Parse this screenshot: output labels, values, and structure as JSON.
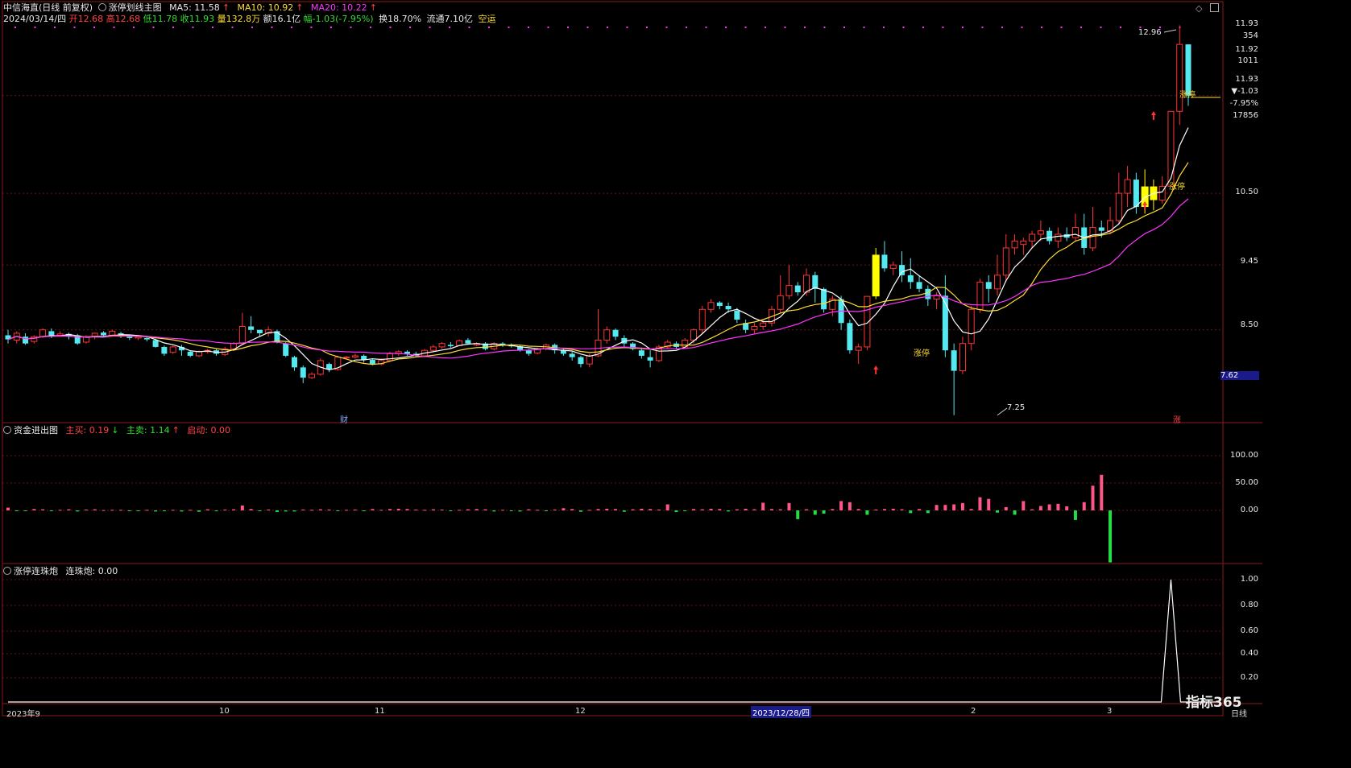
{
  "header": {
    "stock": "中信海直(日线 前复权)",
    "indicator": "涨停划线主图",
    "ma5": "MA5: 11.58",
    "ma10": "MA10: 10.92",
    "ma20": "MA20: 10.22",
    "arrow_up": "↑",
    "arrow_down": "↓",
    "date": "2024/03/14/四",
    "open": "开12.68",
    "high": "高12.68",
    "low": "低11.78",
    "close": "收11.93",
    "volume": "量132.8万",
    "amount": "额16.1亿",
    "change": "幅-1.03(-7.95%)",
    "turnover": "换18.70%",
    "float": "流通7.10亿",
    "concept": "空运"
  },
  "right_panel": {
    "price": "11.93",
    "v354": "354",
    "price2": "11.92",
    "v1011": "1011",
    "price3": "11.93",
    "chg": "▼-1.03",
    "pct": "-7.95%",
    "v17856": "17856"
  },
  "price_axis": [
    "10.50",
    "9.45",
    "8.50",
    "7.62"
  ],
  "annotations": {
    "high_label": "12.96",
    "low_label": "7.25",
    "zt": "涨停",
    "cai": "财",
    "zhang": "涨"
  },
  "panel2": {
    "name": "资金进出图",
    "buy": "主买: 0.19",
    "sell": "主卖: 1.14",
    "start": "启动: 0.00",
    "axis": [
      "100.00",
      "50.00",
      "0.00"
    ]
  },
  "panel3": {
    "name": "涨停连珠炮",
    "value_label": "连珠炮: 0.00",
    "axis": [
      "1.00",
      "0.80",
      "0.60",
      "0.40",
      "0.20"
    ]
  },
  "time_axis": [
    {
      "label": "2023年9"
    },
    {
      "label": "10"
    },
    {
      "label": "11"
    },
    {
      "label": "12"
    },
    {
      "label": "2023/12/28/四"
    },
    {
      "label": "2"
    },
    {
      "label": "3"
    }
  ],
  "period": "日线",
  "brand": "指标365",
  "colors": {
    "up": "#ff3333",
    "down": "#54e8f0",
    "zt": "#ffff00",
    "ma5": "#ffffff",
    "ma10": "#ffdd33",
    "ma20": "#ff33ff",
    "buy": "#ff5588",
    "sell": "#22dd44"
  },
  "chart_data": {
    "type": "candlestick",
    "ylim": [
      7.2,
      13.0
    ],
    "candles": [
      [
        8.42,
        8.36,
        8.5,
        8.3
      ],
      [
        8.35,
        8.45,
        8.48,
        8.3
      ],
      [
        8.4,
        8.3,
        8.45,
        8.28
      ],
      [
        8.33,
        8.4,
        8.42,
        8.3
      ],
      [
        8.4,
        8.5,
        8.52,
        8.38
      ],
      [
        8.48,
        8.42,
        8.52,
        8.38
      ],
      [
        8.42,
        8.44,
        8.48,
        8.4
      ],
      [
        8.44,
        8.4,
        8.46,
        8.36
      ],
      [
        8.42,
        8.3,
        8.44,
        8.28
      ],
      [
        8.32,
        8.4,
        8.42,
        8.3
      ],
      [
        8.4,
        8.45,
        8.46,
        8.36
      ],
      [
        8.46,
        8.42,
        8.48,
        8.4
      ],
      [
        8.42,
        8.48,
        8.5,
        8.4
      ],
      [
        8.45,
        8.4,
        8.47,
        8.38
      ],
      [
        8.4,
        8.38,
        8.42,
        8.35
      ],
      [
        8.38,
        8.4,
        8.42,
        8.35
      ],
      [
        8.38,
        8.36,
        8.4,
        8.33
      ],
      [
        8.35,
        8.25,
        8.37,
        8.24
      ],
      [
        8.25,
        8.15,
        8.27,
        8.12
      ],
      [
        8.17,
        8.25,
        8.27,
        8.15
      ],
      [
        8.25,
        8.2,
        8.28,
        8.12
      ],
      [
        8.18,
        8.12,
        8.2,
        8.1
      ],
      [
        8.12,
        8.18,
        8.2,
        8.1
      ],
      [
        8.18,
        8.2,
        8.22,
        8.15
      ],
      [
        8.2,
        8.15,
        8.22,
        8.12
      ],
      [
        8.14,
        8.22,
        8.25,
        8.12
      ],
      [
        8.22,
        8.3,
        8.32,
        8.2
      ],
      [
        8.3,
        8.55,
        8.75,
        8.28
      ],
      [
        8.55,
        8.5,
        8.7,
        8.45
      ],
      [
        8.5,
        8.45,
        8.5,
        8.4
      ],
      [
        8.45,
        8.5,
        8.55,
        8.4
      ],
      [
        8.48,
        8.32,
        8.5,
        8.3
      ],
      [
        8.3,
        8.12,
        8.32,
        8.1
      ],
      [
        8.1,
        7.95,
        8.12,
        7.9
      ],
      [
        7.95,
        7.8,
        7.98,
        7.72
      ],
      [
        7.8,
        7.85,
        7.88,
        7.78
      ],
      [
        7.85,
        8.05,
        8.08,
        7.83
      ],
      [
        8.0,
        7.92,
        8.02,
        7.88
      ],
      [
        7.92,
        8.1,
        8.12,
        7.9
      ],
      [
        8.1,
        8.1,
        8.12,
        8.08
      ],
      [
        8.1,
        8.12,
        8.15,
        8.08
      ],
      [
        8.12,
        8.06,
        8.14,
        8.02
      ],
      [
        8.06,
        8.0,
        8.08,
        7.98
      ],
      [
        8.0,
        8.05,
        8.08,
        7.98
      ],
      [
        8.05,
        8.15,
        8.18,
        8.03
      ],
      [
        8.15,
        8.18,
        8.2,
        8.12
      ],
      [
        8.18,
        8.15,
        8.2,
        8.12
      ],
      [
        8.15,
        8.12,
        8.18,
        8.1
      ],
      [
        8.12,
        8.2,
        8.22,
        8.1
      ],
      [
        8.2,
        8.25,
        8.28,
        8.18
      ],
      [
        8.25,
        8.3,
        8.32,
        8.22
      ],
      [
        8.28,
        8.26,
        8.32,
        8.24
      ],
      [
        8.27,
        8.34,
        8.36,
        8.26
      ],
      [
        8.35,
        8.3,
        8.38,
        8.28
      ],
      [
        8.28,
        8.3,
        8.32,
        8.26
      ],
      [
        8.3,
        8.22,
        8.32,
        8.2
      ],
      [
        8.22,
        8.3,
        8.32,
        8.2
      ],
      [
        8.3,
        8.28,
        8.32,
        8.25
      ],
      [
        8.27,
        8.26,
        8.3,
        8.24
      ],
      [
        8.26,
        8.2,
        8.28,
        8.18
      ],
      [
        8.2,
        8.15,
        8.22,
        8.12
      ],
      [
        8.16,
        8.22,
        8.24,
        8.14
      ],
      [
        8.22,
        8.28,
        8.3,
        8.2
      ],
      [
        8.28,
        8.2,
        8.3,
        8.15
      ],
      [
        8.2,
        8.15,
        8.22,
        8.12
      ],
      [
        8.15,
        8.1,
        8.18,
        8.05
      ],
      [
        8.1,
        8.0,
        8.12,
        7.95
      ],
      [
        8.0,
        8.12,
        8.15,
        7.95
      ],
      [
        8.12,
        8.35,
        8.8,
        8.1
      ],
      [
        8.35,
        8.5,
        8.55,
        8.3
      ],
      [
        8.5,
        8.4,
        8.52,
        8.35
      ],
      [
        8.38,
        8.3,
        8.42,
        8.25
      ],
      [
        8.3,
        8.22,
        8.32,
        8.2
      ],
      [
        8.2,
        8.12,
        8.24,
        8.08
      ],
      [
        8.1,
        8.05,
        8.2,
        7.95
      ],
      [
        8.05,
        8.25,
        8.28,
        8.03
      ],
      [
        8.25,
        8.32,
        8.35,
        8.22
      ],
      [
        8.3,
        8.25,
        8.33,
        8.22
      ],
      [
        8.25,
        8.35,
        8.38,
        8.24
      ],
      [
        8.35,
        8.5,
        8.52,
        8.3
      ],
      [
        8.5,
        8.8,
        8.85,
        8.45
      ],
      [
        8.8,
        8.9,
        8.95,
        8.75
      ],
      [
        8.9,
        8.85,
        8.92,
        8.8
      ],
      [
        8.85,
        8.8,
        8.9,
        8.75
      ],
      [
        8.78,
        8.65,
        8.82,
        8.6
      ],
      [
        8.6,
        8.5,
        8.65,
        8.45
      ],
      [
        8.5,
        8.55,
        8.6,
        8.45
      ],
      [
        8.55,
        8.6,
        8.65,
        8.5
      ],
      [
        8.6,
        8.8,
        8.85,
        8.55
      ],
      [
        8.8,
        9.0,
        9.3,
        8.75
      ],
      [
        9.0,
        9.15,
        9.45,
        8.95
      ],
      [
        9.15,
        9.05,
        9.2,
        9.0
      ],
      [
        9.05,
        9.3,
        9.4,
        9.0
      ],
      [
        9.3,
        9.1,
        9.35,
        8.9
      ],
      [
        9.1,
        8.8,
        9.12,
        8.75
      ],
      [
        8.8,
        8.95,
        9.0,
        8.7
      ],
      [
        8.95,
        8.6,
        9.0,
        8.5
      ],
      [
        8.6,
        8.2,
        8.65,
        8.15
      ],
      [
        8.2,
        8.25,
        8.3,
        8.0
      ],
      [
        8.25,
        8.99,
        8.99,
        8.2
      ],
      [
        8.99,
        9.6,
        9.7,
        8.95
      ],
      [
        9.6,
        9.4,
        9.8,
        9.35
      ],
      [
        9.4,
        9.45,
        9.5,
        9.3
      ],
      [
        9.45,
        9.3,
        9.65,
        9.2
      ],
      [
        9.3,
        9.2,
        9.55,
        9.1
      ],
      [
        9.2,
        9.1,
        9.3,
        9.05
      ],
      [
        9.1,
        8.95,
        9.15,
        8.85
      ],
      [
        8.95,
        9.0,
        9.05,
        8.8
      ],
      [
        9.0,
        8.2,
        9.3,
        8.1
      ],
      [
        8.2,
        7.9,
        8.3,
        7.25
      ],
      [
        7.9,
        8.3,
        8.4,
        7.85
      ],
      [
        8.3,
        8.8,
        8.85,
        8.2
      ],
      [
        8.8,
        9.2,
        9.25,
        8.75
      ],
      [
        9.2,
        9.1,
        9.3,
        8.9
      ],
      [
        9.1,
        9.3,
        9.6,
        9.0
      ],
      [
        9.3,
        9.7,
        9.9,
        9.2
      ],
      [
        9.7,
        9.8,
        9.9,
        9.6
      ],
      [
        9.75,
        9.8,
        9.85,
        9.6
      ],
      [
        9.8,
        9.9,
        9.95,
        9.7
      ],
      [
        9.9,
        9.95,
        10.1,
        9.8
      ],
      [
        9.95,
        9.8,
        10.0,
        9.75
      ],
      [
        9.8,
        9.9,
        10.0,
        9.7
      ],
      [
        9.9,
        9.85,
        10.0,
        9.8
      ],
      [
        9.85,
        10.0,
        10.2,
        9.8
      ],
      [
        10.0,
        9.7,
        10.2,
        9.6
      ],
      [
        9.7,
        10.0,
        10.3,
        9.65
      ],
      [
        10.0,
        9.95,
        10.1,
        9.85
      ],
      [
        9.95,
        10.1,
        10.3,
        9.9
      ],
      [
        10.1,
        10.5,
        10.8,
        10.05
      ],
      [
        10.5,
        10.7,
        10.9,
        10.3
      ],
      [
        10.7,
        10.3,
        10.8,
        10.2
      ],
      [
        10.3,
        10.6,
        10.85,
        10.2
      ],
      [
        10.6,
        10.4,
        10.7,
        10.25
      ],
      [
        10.4,
        10.6,
        10.75,
        10.35
      ],
      [
        10.6,
        11.7,
        11.7,
        10.6
      ],
      [
        11.7,
        12.68,
        12.96,
        11.5
      ],
      [
        12.68,
        11.93,
        12.68,
        11.78
      ]
    ],
    "ma5": [],
    "flow": [
      0.1,
      -0.03,
      -0.02,
      0.05,
      0.04,
      -0.03,
      0.02,
      0.04,
      -0.04,
      0.03,
      0.04,
      0.01,
      0.02,
      0.02,
      -0.02,
      -0.03,
      0.02,
      -0.04,
      -0.03,
      0.02,
      -0.04,
      0.02,
      -0.05,
      0.04,
      -0.03,
      0.03,
      0.04,
      0.18,
      0.05,
      -0.02,
      0.03,
      -0.06,
      -0.04,
      -0.04,
      0.03,
      0.02,
      0.04,
      0.03,
      -0.02,
      0.02,
      0.03,
      -0.02,
      0.05,
      0.02,
      0.05,
      0.06,
      0.05,
      0.03,
      0.02,
      0.04,
      0.03,
      -0.03,
      0.02,
      0.04,
      0.05,
      0.04,
      -0.04,
      0.02,
      -0.03,
      -0.04,
      0.04,
      0.02,
      -0.03,
      0.03,
      0.08,
      0.05,
      -0.05,
      0.02,
      0.05,
      0.06,
      0.05,
      -0.05,
      0.04,
      0.06,
      0.05,
      0.03,
      0.22,
      -0.06,
      -0.03,
      0.05,
      0.04,
      0.06,
      0.05,
      -0.04,
      0.04,
      0.06,
      0.04,
      0.28,
      0.05,
      0.04,
      0.27,
      -0.32,
      0.04,
      -0.16,
      -0.12,
      0.05,
      0.34,
      0.3,
      0.05,
      -0.16,
      0.03,
      0.05,
      0.06,
      0.04,
      -0.1,
      0.05,
      -0.1,
      0.2,
      0.2,
      0.22,
      0.27,
      0.05,
      0.48,
      0.42,
      -0.08,
      0.12,
      -0.16,
      0.34,
      0.04,
      0.16,
      0.22,
      0.24,
      0.15,
      -0.35,
      0.3,
      0.9,
      1.3,
      -1.9
    ],
    "lianzhu_peak": 1.0
  }
}
